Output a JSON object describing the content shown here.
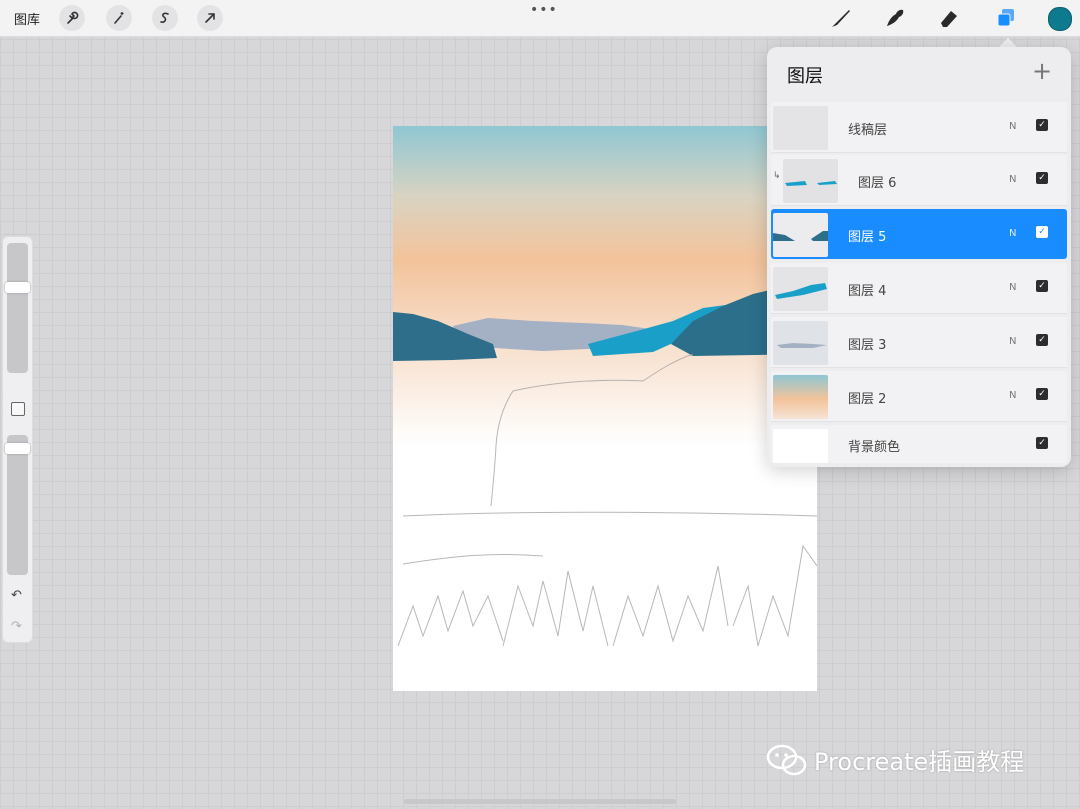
{
  "toolbar": {
    "gallery_label": "图库",
    "left_icons": [
      "wrench-icon",
      "magic-wand-icon",
      "selection-icon",
      "transform-arrow-icon"
    ],
    "more_dots": "•••",
    "right_icons": [
      "brush-icon",
      "smudge-icon",
      "eraser-icon",
      "layers-icon"
    ],
    "current_color": "#0d7a8d"
  },
  "sidebar": {
    "undo": "↶",
    "redo": "↷"
  },
  "layers_panel": {
    "title": "图层",
    "add_symbol": "+",
    "layers": [
      {
        "name": "线稿层",
        "blend": "N",
        "visible": true,
        "selected": false
      },
      {
        "name": "图层 6",
        "blend": "N",
        "visible": true,
        "selected": false,
        "clipped": true
      },
      {
        "name": "图层 5",
        "blend": "N",
        "visible": true,
        "selected": true
      },
      {
        "name": "图层 4",
        "blend": "N",
        "visible": true,
        "selected": false
      },
      {
        "name": "图层 3",
        "blend": "N",
        "visible": true,
        "selected": false
      },
      {
        "name": "图层 2",
        "blend": "N",
        "visible": true,
        "selected": false
      },
      {
        "name": "背景颜色",
        "blend": "",
        "visible": true,
        "selected": false
      }
    ]
  },
  "watermark": {
    "text": "Procreate插画教程"
  },
  "colors": {
    "accent_blue": "#198cff",
    "sky_top": "#8fc7d3",
    "sky_bottom": "#f3c39a",
    "mountain_teal": "#1aa0c8",
    "mountain_dark": "#2c6f8a"
  }
}
